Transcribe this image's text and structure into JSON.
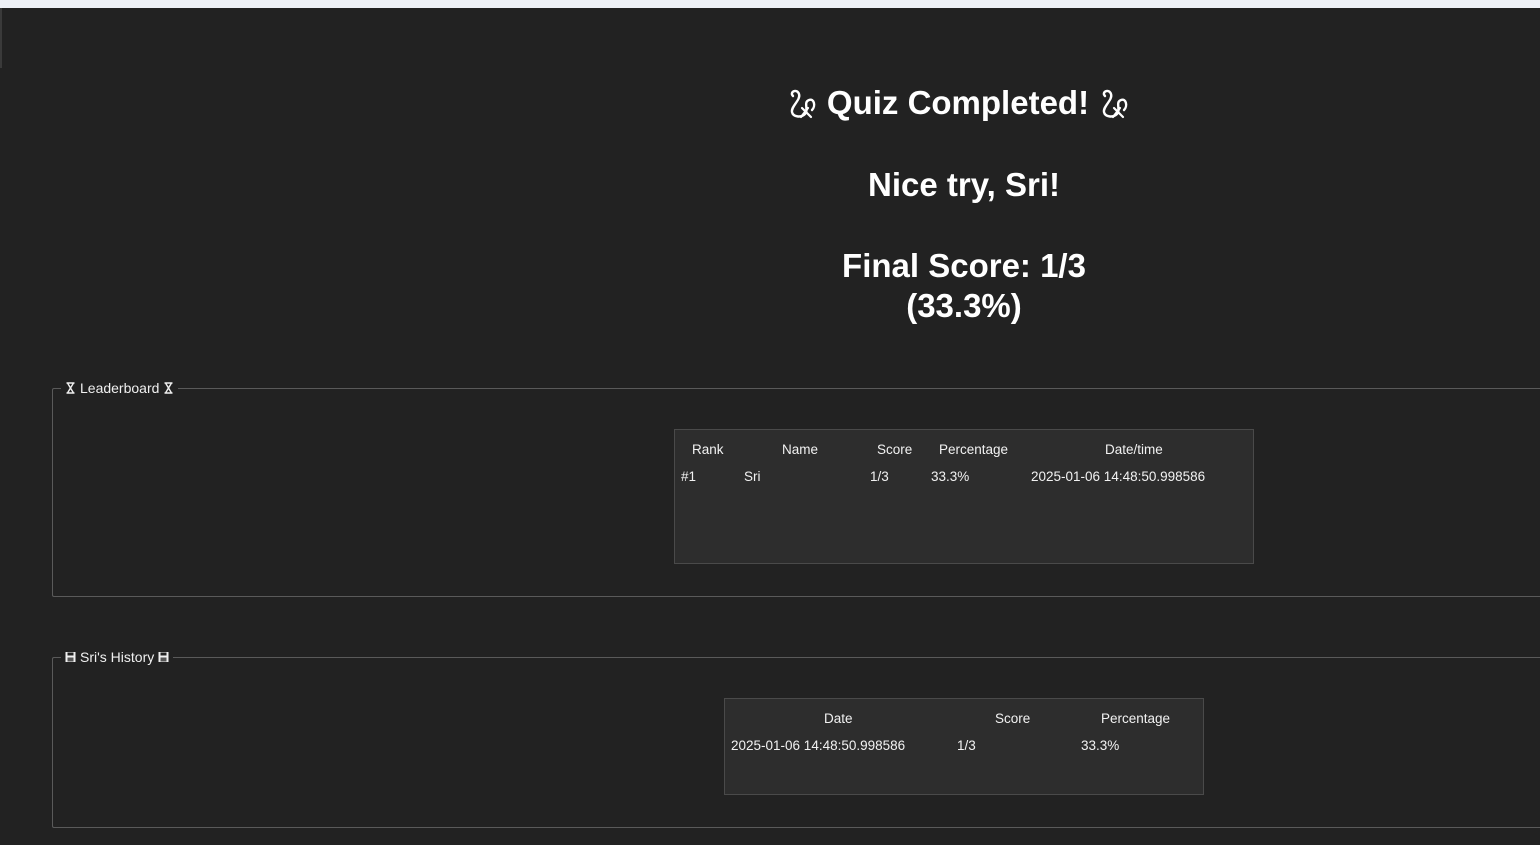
{
  "result": {
    "title": "Quiz Completed!",
    "title_emoji": "🎊-style icon",
    "message": "Nice try, Sri!",
    "score_line1": "Final Score: 1/3",
    "score_line2": "(33.3%)"
  },
  "leaderboard": {
    "title": "Leaderboard",
    "icon": "hourglass-icon",
    "columns": [
      "Rank",
      "Name",
      "Score",
      "Percentage",
      "Date/time"
    ],
    "rows": [
      [
        "#1",
        "Sri",
        "1/3",
        "33.3%",
        "2025-01-06 14:48:50.998586"
      ]
    ]
  },
  "history": {
    "title": "Sri's History",
    "icon": "floppy-disk-icon",
    "columns": [
      "Date",
      "Score",
      "Percentage"
    ],
    "rows": [
      [
        "2025-01-06 14:48:50.998586",
        "1/3",
        "33.3%"
      ]
    ]
  },
  "colors": {
    "background": "#222222",
    "table_background": "#2d2d2d",
    "border": "#5a5a5a",
    "text": "#ffffff"
  }
}
